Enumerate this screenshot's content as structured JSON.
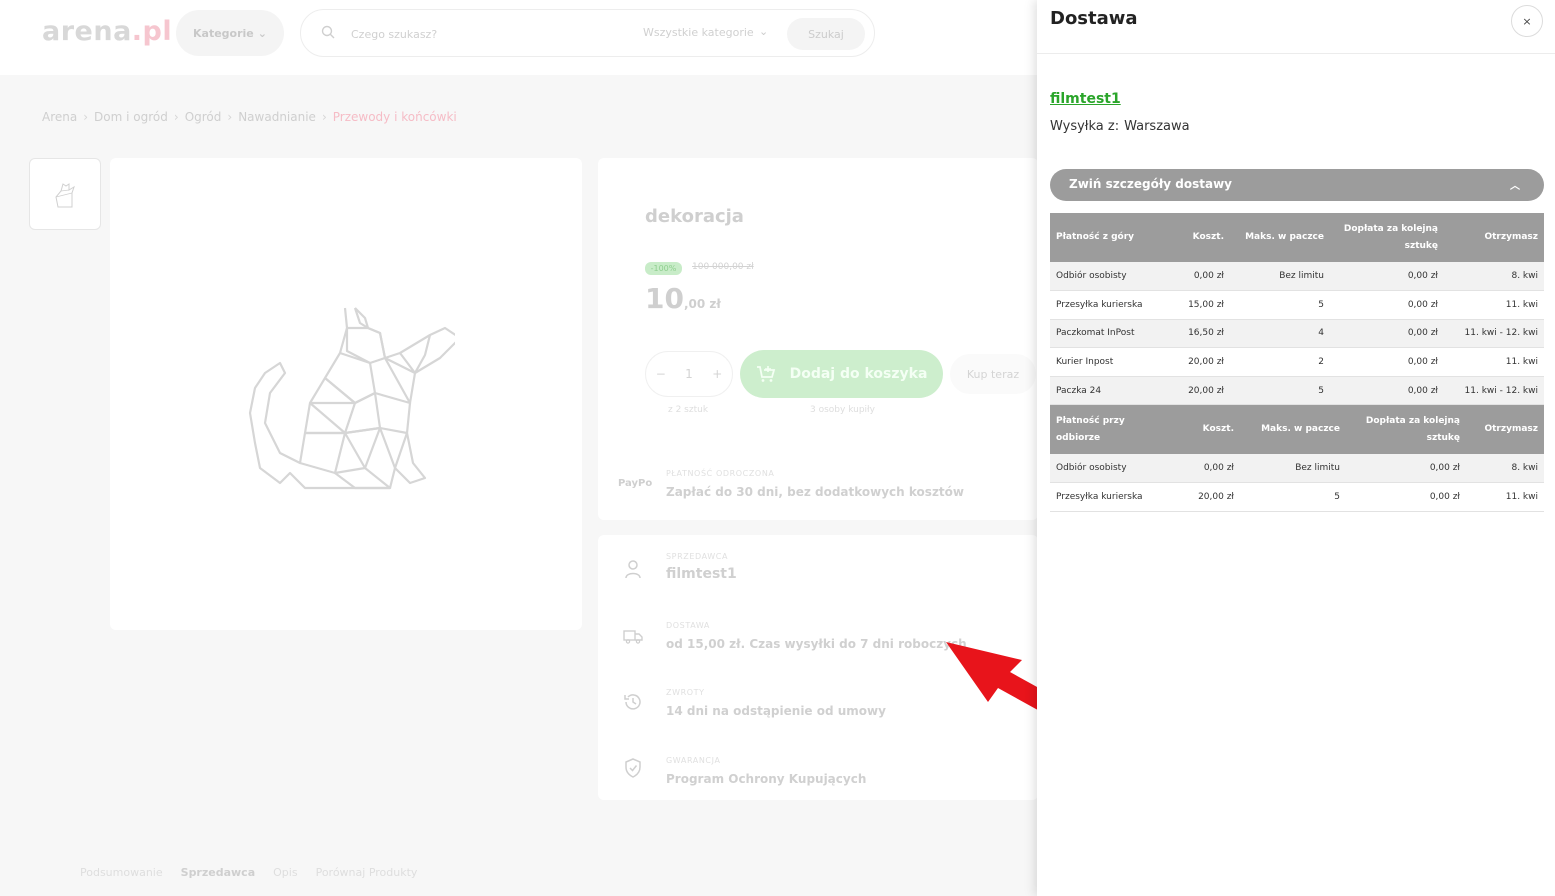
{
  "header": {
    "logo_main": "arena",
    "logo_suffix": ".pl",
    "categories_label": "Kategorie",
    "search_placeholder": "Czego szukasz?",
    "search_category": "Wszystkie kategorie",
    "search_button": "Szukaj"
  },
  "breadcrumb": [
    "Arena",
    "Dom i ogród",
    "Ogród",
    "Nawadnianie",
    "Przewody i końcówki"
  ],
  "product": {
    "title": "dekoracja",
    "discount_badge": "-100%",
    "old_price": "100 000,00 zł",
    "price_main": "10",
    "price_rest": ",00 zł",
    "quantity": "1",
    "qty_minus": "−",
    "qty_plus": "+",
    "qty_note": "z 2 sztuk",
    "add_to_cart": "Dodaj do koszyka",
    "cart_note": "3 osoby kupiły",
    "buy_now": "Kup teraz",
    "paypo_logo": "PayPo",
    "paypo_label": "PŁATNOŚĆ ODROCZONA",
    "paypo_text": "Zapłać do 30 dni, bez dodatkowych kosztów"
  },
  "info": {
    "seller_label": "SPRZEDAWCA",
    "seller_name": "filmtest1",
    "delivery_label": "DOSTAWA",
    "delivery_text": "od 15,00 zł. Czas wysyłki do 7 dni roboczych",
    "returns_label": "ZWROTY",
    "returns_text": "14 dni na odstąpienie od umowy",
    "warranty_label": "GWARANCJA",
    "warranty_text": "Program Ochrony Kupujących"
  },
  "tabs": [
    "Podsumowanie",
    "Sprzedawca",
    "Opis",
    "Porównaj Produkty"
  ],
  "drawer": {
    "title": "Dostawa",
    "close": "×",
    "seller": "filmtest1",
    "from_label": "Wysyłka z:",
    "from_value": "Warszawa",
    "collapse_label": "Zwiń szczegóły dostawy",
    "prepaid": {
      "headers": [
        "Płatność z góry",
        "Koszt.",
        "Maks. w paczce",
        "Dopłata za kolejną sztukę",
        "Otrzymasz"
      ],
      "rows": [
        [
          "Odbiór osobisty",
          "0,00 zł",
          "Bez limitu",
          "0,00 zł",
          "8. kwi"
        ],
        [
          "Przesyłka kurierska",
          "15,00 zł",
          "5",
          "0,00 zł",
          "11. kwi"
        ],
        [
          "Paczkomat InPost",
          "16,50 zł",
          "4",
          "0,00 zł",
          "11. kwi - 12. kwi"
        ],
        [
          "Kurier Inpost",
          "20,00 zł",
          "2",
          "0,00 zł",
          "11. kwi"
        ],
        [
          "Paczka 24",
          "20,00 zł",
          "5",
          "0,00 zł",
          "11. kwi - 12. kwi"
        ]
      ]
    },
    "cod": {
      "headers": [
        "Płatność przy odbiorze",
        "Koszt.",
        "Maks. w paczce",
        "Dopłata za kolejną sztukę",
        "Otrzymasz"
      ],
      "rows": [
        [
          "Odbiór osobisty",
          "0,00 zł",
          "Bez limitu",
          "0,00 zł",
          "8. kwi"
        ],
        [
          "Przesyłka kurierska",
          "20,00 zł",
          "5",
          "0,00 zł",
          "11. kwi"
        ]
      ]
    }
  },
  "colors": {
    "accent_green": "#2aa52a",
    "table_header": "#9c9c9c",
    "arrow_red": "#e8141b"
  }
}
